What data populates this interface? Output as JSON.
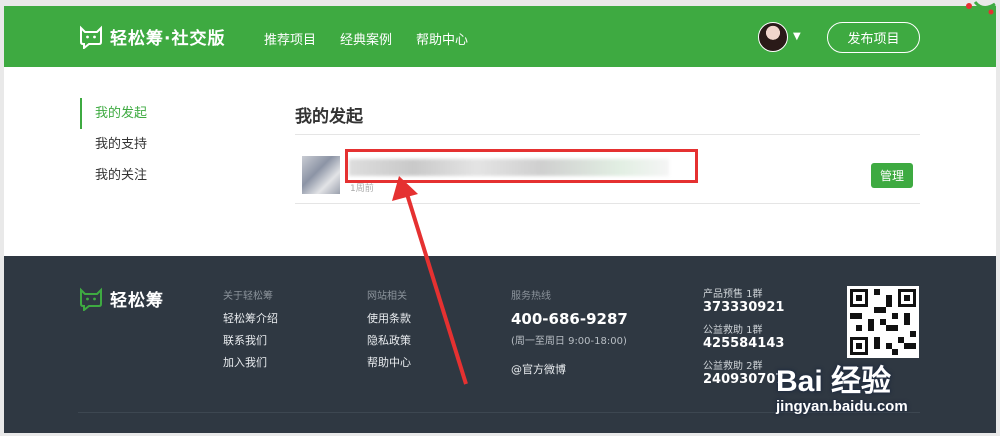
{
  "header": {
    "brand": "轻松筹·社交版",
    "nav": [
      "推荐项目",
      "经典案例",
      "帮助中心"
    ],
    "publish_label": "发布项目"
  },
  "sidebar": {
    "items": [
      {
        "label": "我的发起",
        "active": true
      },
      {
        "label": "我的支持",
        "active": false
      },
      {
        "label": "我的关注",
        "active": false
      }
    ]
  },
  "main": {
    "title": "我的发起",
    "project": {
      "title": "",
      "time": "1周前",
      "manage_label": "管理"
    }
  },
  "footer": {
    "brand": "轻松筹",
    "about": {
      "head": "关于轻松筹",
      "links": [
        "轻松筹介绍",
        "联系我们",
        "加入我们"
      ]
    },
    "site": {
      "head": "网站相关",
      "links": [
        "使用条款",
        "隐私政策",
        "帮助中心"
      ]
    },
    "service": {
      "head": "服务热线",
      "phone": "400-686-9287",
      "hours": "(周一至周日 9:00-18:00)",
      "weibo": "@官方微博"
    },
    "groups": [
      {
        "label": "产品预售 1群",
        "number": "373330921"
      },
      {
        "label": "公益救助 1群",
        "number": "425584143"
      },
      {
        "label": "公益救助 2群",
        "number": "240930707"
      }
    ]
  },
  "watermark": {
    "brand": "Bai 经验",
    "url": "jingyan.baidu.com"
  },
  "colors": {
    "brand_green": "#3eaa41",
    "footer_bg": "#2f3842",
    "highlight_red": "#e53131"
  }
}
